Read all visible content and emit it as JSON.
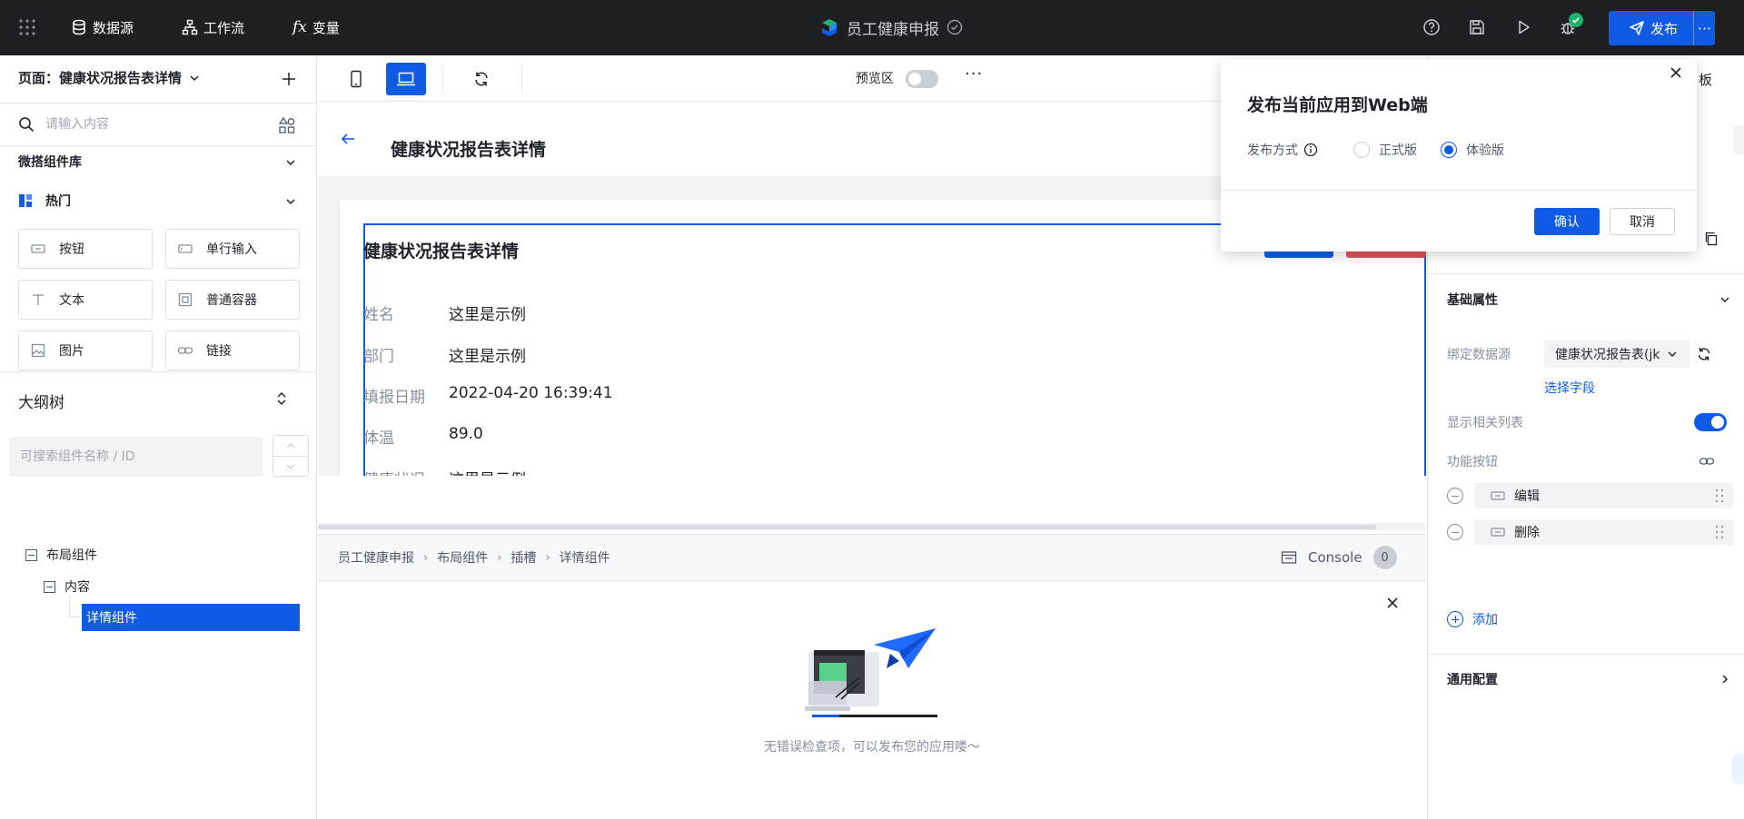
{
  "topbar": {
    "nav": [
      {
        "label": "数据源",
        "icon": "database-icon"
      },
      {
        "label": "工作流",
        "icon": "workflow-icon"
      },
      {
        "label": "变量",
        "icon": "function-fx-icon"
      }
    ],
    "app_title": "员工健康申报",
    "publish_label": "发布",
    "more_label": "···",
    "colors": {
      "bg": "#1e1f22",
      "accent": "#0f5be6",
      "status_ok": "#1fb36b"
    }
  },
  "left": {
    "page_select": "页面：健康状况报告表详情",
    "search_placeholder": "请输入内容",
    "library_title": "微搭组件库",
    "hot_label": "热门",
    "components": [
      {
        "label": "按钮",
        "icon": "button-icon"
      },
      {
        "label": "单行输入",
        "icon": "input-icon"
      },
      {
        "label": "文本",
        "icon": "text-icon"
      },
      {
        "label": "普通容器",
        "icon": "container-icon"
      },
      {
        "label": "图片",
        "icon": "image-icon"
      },
      {
        "label": "链接",
        "icon": "link-icon"
      }
    ],
    "outline_title": "大纲树",
    "outline_search_placeholder": "可搜索组件名称 / ID",
    "tree": {
      "layout": "布局组件",
      "content": "内容",
      "detail": "详情组件"
    }
  },
  "toolbar": {
    "preview_label": "预览区",
    "more_label": "···"
  },
  "canvas": {
    "page_title": "健康状况报告表详情",
    "detail_title": "健康状况报告表详情",
    "fields": [
      {
        "label": "姓名",
        "value": "这里是示例"
      },
      {
        "label": "部门",
        "value": "这里是示例"
      },
      {
        "label": "填报日期",
        "value": "2022-04-20 16:39:41"
      },
      {
        "label": "体温",
        "value": "89.0"
      },
      {
        "label": "健康状况",
        "value": "这里是示例"
      }
    ]
  },
  "bottom": {
    "crumbs": [
      "员工健康申报",
      "布局组件",
      "插槽",
      "详情组件"
    ],
    "console_label": "Console",
    "console_count": "0",
    "empty_text": "无错误检查项，可以发布您的应用喽～"
  },
  "right": {
    "partial_text": "板",
    "basic_props": "基础属性",
    "bind_source_label": "绑定数据源",
    "bind_source_value": "健康状况报告表(jk",
    "choose_field": "选择字段",
    "show_related_label": "显示相关列表",
    "fn_buttons_label": "功能按钮",
    "fn_buttons": [
      "编辑",
      "删除"
    ],
    "add_label": "添加",
    "general_config": "通用配置"
  },
  "popup": {
    "title": "发布当前应用到Web端",
    "mode_label": "发布方式",
    "options": [
      {
        "label": "正式版",
        "checked": false
      },
      {
        "label": "体验版",
        "checked": true
      }
    ],
    "confirm_label": "确认",
    "cancel_label": "取消"
  }
}
